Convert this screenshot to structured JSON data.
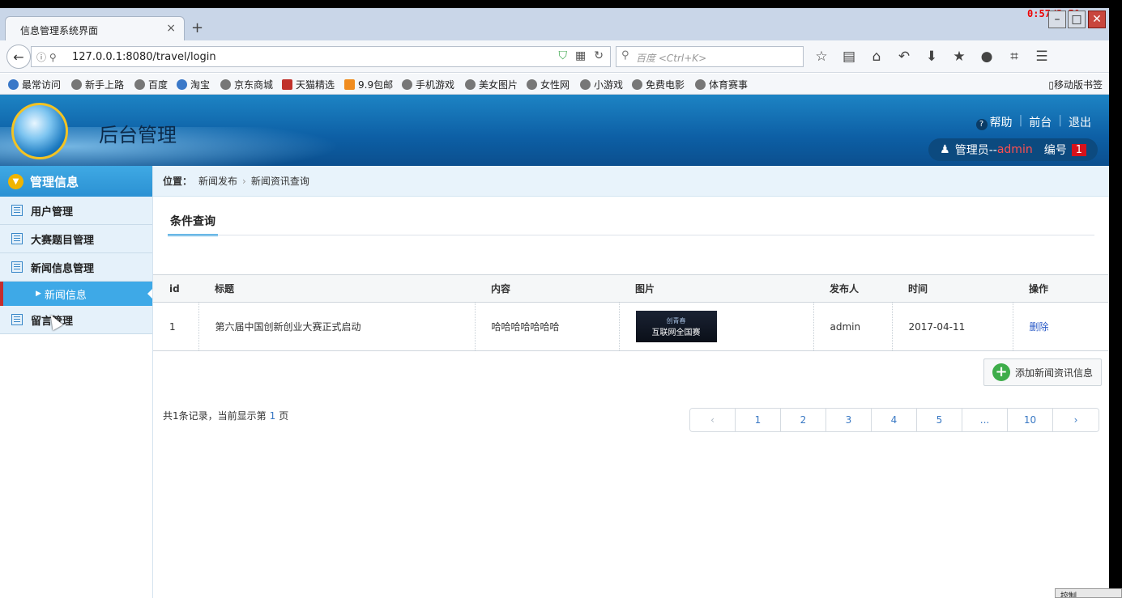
{
  "clock": "0:57/3:50",
  "browser": {
    "tab_title": "信息管理系统界面",
    "tab_close": "×",
    "new_tab": "+",
    "url": "127.0.0.1:8080/travel/login",
    "search_placeholder": "百度 <Ctrl+K>",
    "bookmarks": [
      "最常访问",
      "新手上路",
      "百度",
      "淘宝",
      "京东商城",
      "天猫精选",
      "9.9包邮",
      "手机游戏",
      "美女图片",
      "女性网",
      "小游戏",
      "免费电影",
      "体育赛事"
    ],
    "mobile_bookmarks": "移动版书签"
  },
  "header": {
    "title": "后台管理",
    "help": "帮助",
    "front": "前台",
    "logout": "退出",
    "user_prefix": "管理员--",
    "user_name": "admin",
    "num_label": "编号",
    "num_value": "1"
  },
  "sidebar": {
    "head": "管理信息",
    "items": [
      {
        "label": "用户管理"
      },
      {
        "label": "大赛题目管理"
      },
      {
        "label": "新闻信息管理"
      },
      {
        "label": "新闻信息"
      },
      {
        "label": "留言管理"
      }
    ]
  },
  "main": {
    "crumb_label": "位置：",
    "crumb_1": "新闻发布",
    "crumb_sep": "›",
    "crumb_2": "新闻资讯查询",
    "query_tab": "条件查询",
    "columns": [
      "id",
      "标题",
      "内容",
      "图片",
      "发布人",
      "时间",
      "操作"
    ],
    "rows": [
      {
        "id": "1",
        "title": "第六届中国创新创业大赛正式启动",
        "content": "哈哈哈哈哈哈哈",
        "image_line1": "创青春",
        "image_line2": "互联网全国赛",
        "author": "admin",
        "date": "2017-04-11",
        "action": "删除"
      }
    ],
    "add_button": "添加新闻资讯信息",
    "rec_text_1": "共1条记录，当前显示第",
    "rec_page": "1",
    "rec_text_2": "页",
    "pager": [
      "‹",
      "1",
      "2",
      "3",
      "4",
      "5",
      "...",
      "10",
      "›"
    ]
  },
  "taskbar_hint": "控制"
}
